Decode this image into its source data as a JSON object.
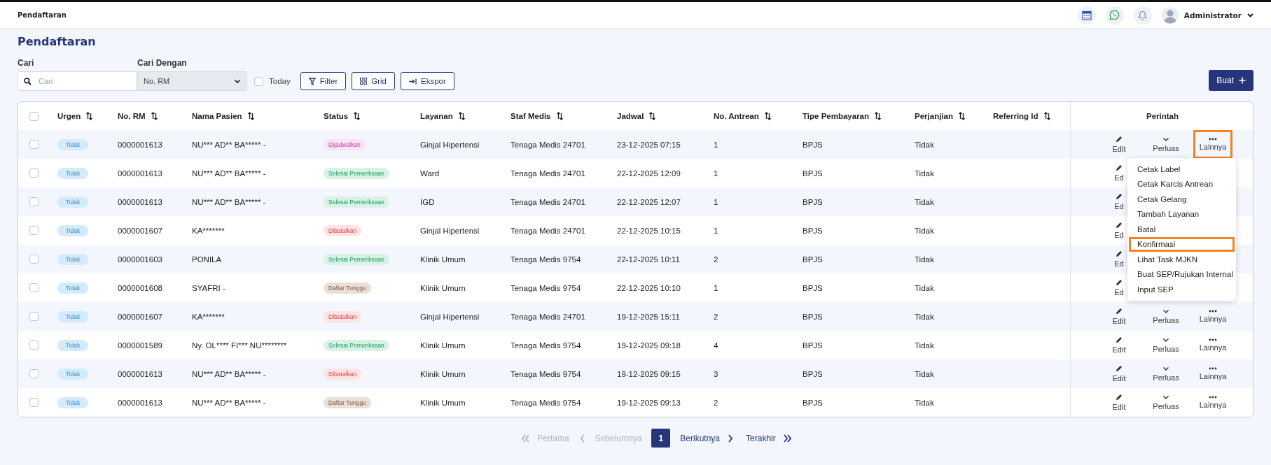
{
  "topbar": {
    "title": "Pendaftaran",
    "user": "Administrator"
  },
  "page_title": "Pendaftaran",
  "search": {
    "label": "Cari",
    "placeholder": "Cari"
  },
  "search_by": {
    "label": "Cari Dengan",
    "value": "No. RM"
  },
  "today": {
    "label": "Today",
    "checked": false
  },
  "buttons": [
    {
      "kind": "filter",
      "label": "Filter"
    },
    {
      "kind": "grid",
      "label": "Grid"
    },
    {
      "kind": "export",
      "label": "Ekspor"
    }
  ],
  "create_button": {
    "label": "Buat"
  },
  "table": {
    "select_all_checked": false,
    "columns": [
      {
        "label": "Urgen",
        "sortable": true
      },
      {
        "label": "No. RM",
        "sortable": true
      },
      {
        "label": "Nama Pasien",
        "sortable": true
      },
      {
        "label": "Status",
        "sortable": true
      },
      {
        "label": "Layanan",
        "sortable": true
      },
      {
        "label": "Staf Medis",
        "sortable": true
      },
      {
        "label": "Jadwal",
        "sortable": true
      },
      {
        "label": "No. Antrean",
        "sortable": true
      },
      {
        "label": "Tipe Pembayaran",
        "sortable": true
      },
      {
        "label": "Perjanjian",
        "sortable": true
      },
      {
        "label": "Referring Id",
        "sortable": true
      },
      {
        "label": "Perintah",
        "sortable": false
      }
    ],
    "rows": [
      {
        "checked": false,
        "urgent": "Tidak",
        "rm": "0000001613",
        "name": "NU*** AD** BA***** -",
        "status": {
          "label": "Dijadwalkan",
          "kind": "scheduled"
        },
        "service": "Ginjal Hipertensi",
        "staff": "Tenaga Medis 24701",
        "schedule": "23-12-2025 07:15",
        "queue": "1",
        "payment": "BPJS",
        "agreement": "Tidak",
        "actions": [
          {
            "kind": "edit",
            "label": "Edit",
            "highlighted": false
          },
          {
            "kind": "expand",
            "label": "Perluas",
            "highlighted": false
          },
          {
            "kind": "more",
            "label": "Lainnya",
            "highlighted": true
          }
        ],
        "menu": [
          {
            "label": "Cetak Label",
            "highlighted": false
          },
          {
            "label": "Cetak Karcis Antrean",
            "highlighted": false
          },
          {
            "label": "Cetak Gelang",
            "highlighted": false
          },
          {
            "label": "Tambah Layanan",
            "highlighted": false
          },
          {
            "label": "Batal",
            "highlighted": false
          },
          {
            "label": "Konfirmasi",
            "highlighted": true
          },
          {
            "label": "Lihat Task MJKN",
            "highlighted": false
          },
          {
            "label": "Buat SEP/Rujukan Internal",
            "highlighted": false
          },
          {
            "label": "Input SEP",
            "highlighted": false
          }
        ]
      },
      {
        "checked": false,
        "urgent": "Tidak",
        "rm": "0000001613",
        "name": "NU*** AD** BA***** -",
        "status": {
          "label": "Selesai Pemeriksaan",
          "kind": "done"
        },
        "service": "Ward",
        "staff": "Tenaga Medis 24701",
        "schedule": "22-12-2025 12:09",
        "queue": "1",
        "payment": "BPJS",
        "agreement": "Tidak",
        "actions": [
          {
            "kind": "edit",
            "label": "Ed",
            "highlighted": false
          }
        ]
      },
      {
        "checked": false,
        "urgent": "Tidak",
        "rm": "0000001613",
        "name": "NU*** AD** BA***** -",
        "status": {
          "label": "Selesai Pemeriksaan",
          "kind": "done"
        },
        "service": "IGD",
        "staff": "Tenaga Medis 24701",
        "schedule": "22-12-2025 12:07",
        "queue": "1",
        "payment": "BPJS",
        "agreement": "Tidak",
        "actions": [
          {
            "kind": "edit",
            "label": "Ed",
            "highlighted": false
          }
        ]
      },
      {
        "checked": false,
        "urgent": "Tidak",
        "rm": "0000001607",
        "name": "KA*******",
        "status": {
          "label": "Dibatalkan",
          "kind": "cancelled"
        },
        "service": "Ginjal Hipertensi",
        "staff": "Tenaga Medis 24701",
        "schedule": "22-12-2025 10:15",
        "queue": "1",
        "payment": "BPJS",
        "agreement": "Tidak",
        "actions": [
          {
            "kind": "edit",
            "label": "Ed",
            "highlighted": false
          }
        ]
      },
      {
        "checked": false,
        "urgent": "Tidak",
        "rm": "0000001603",
        "name": "PONILA",
        "status": {
          "label": "Selesai Pemeriksaan",
          "kind": "done"
        },
        "service": "Klinik Umum",
        "staff": "Tenaga Medis 9754",
        "schedule": "22-12-2025 10:11",
        "queue": "2",
        "payment": "BPJS",
        "agreement": "Tidak",
        "actions": [
          {
            "kind": "edit",
            "label": "Ed",
            "highlighted": false
          }
        ]
      },
      {
        "checked": false,
        "urgent": "Tidak",
        "rm": "0000001608",
        "name": "SYAFRI -",
        "status": {
          "label": "Daftar Tunggu",
          "kind": "waiting"
        },
        "service": "Klinik Umum",
        "staff": "Tenaga Medis 9754",
        "schedule": "22-12-2025 10:10",
        "queue": "1",
        "payment": "BPJS",
        "agreement": "Tidak",
        "actions": [
          {
            "kind": "edit",
            "label": "Ed",
            "highlighted": false
          }
        ]
      },
      {
        "checked": false,
        "urgent": "Tidak",
        "rm": "0000001607",
        "name": "KA*******",
        "status": {
          "label": "Dibatalkan",
          "kind": "cancelled"
        },
        "service": "Ginjal Hipertensi",
        "staff": "Tenaga Medis 24701",
        "schedule": "19-12-2025 15:11",
        "queue": "2",
        "payment": "BPJS",
        "agreement": "Tidak",
        "actions": [
          {
            "kind": "edit",
            "label": "Edit",
            "highlighted": false
          },
          {
            "kind": "expand",
            "label": "Perluas",
            "highlighted": false
          },
          {
            "kind": "more",
            "label": "Lainnya",
            "highlighted": false
          }
        ]
      },
      {
        "checked": false,
        "urgent": "Tidak",
        "rm": "0000001589",
        "name": "Ny. OL**** FI*** NU********",
        "status": {
          "label": "Selesai Pemeriksaan",
          "kind": "done"
        },
        "service": "Klinik Umum",
        "staff": "Tenaga Medis 9754",
        "schedule": "19-12-2025 09:18",
        "queue": "4",
        "payment": "BPJS",
        "agreement": "Tidak",
        "actions": [
          {
            "kind": "edit",
            "label": "Edit",
            "highlighted": false
          },
          {
            "kind": "expand",
            "label": "Perluas",
            "highlighted": false
          },
          {
            "kind": "more",
            "label": "Lainnya",
            "highlighted": false
          }
        ]
      },
      {
        "checked": false,
        "urgent": "Tidak",
        "rm": "0000001613",
        "name": "NU*** AD** BA***** -",
        "status": {
          "label": "Dibatalkan",
          "kind": "cancelled"
        },
        "service": "Klinik Umum",
        "staff": "Tenaga Medis 9754",
        "schedule": "19-12-2025 09:15",
        "queue": "3",
        "payment": "BPJS",
        "agreement": "Tidak",
        "actions": [
          {
            "kind": "edit",
            "label": "Edit",
            "highlighted": false
          },
          {
            "kind": "expand",
            "label": "Perluas",
            "highlighted": false
          },
          {
            "kind": "more",
            "label": "Lainnya",
            "highlighted": false
          }
        ]
      },
      {
        "checked": false,
        "urgent": "Tidak",
        "rm": "0000001613",
        "name": "NU*** AD** BA***** -",
        "status": {
          "label": "Daftar Tunggu",
          "kind": "waiting"
        },
        "service": "Klinik Umum",
        "staff": "Tenaga Medis 9754",
        "schedule": "19-12-2025 09:13",
        "queue": "2",
        "payment": "BPJS",
        "agreement": "Tidak",
        "actions": [
          {
            "kind": "edit",
            "label": "Edit",
            "highlighted": false
          },
          {
            "kind": "expand",
            "label": "Perluas",
            "highlighted": false
          },
          {
            "kind": "more",
            "label": "Lainnya",
            "highlighted": false
          }
        ]
      }
    ]
  },
  "pagination": [
    {
      "kind": "first",
      "label": "Pertama",
      "disabled": true
    },
    {
      "kind": "prev",
      "label": "Sebelumnya",
      "disabled": true
    },
    {
      "kind": "page",
      "label": "1",
      "selected": true
    },
    {
      "kind": "next",
      "label": "Berikutnya",
      "disabled": false
    },
    {
      "kind": "last",
      "label": "Terakhir",
      "disabled": false
    }
  ]
}
